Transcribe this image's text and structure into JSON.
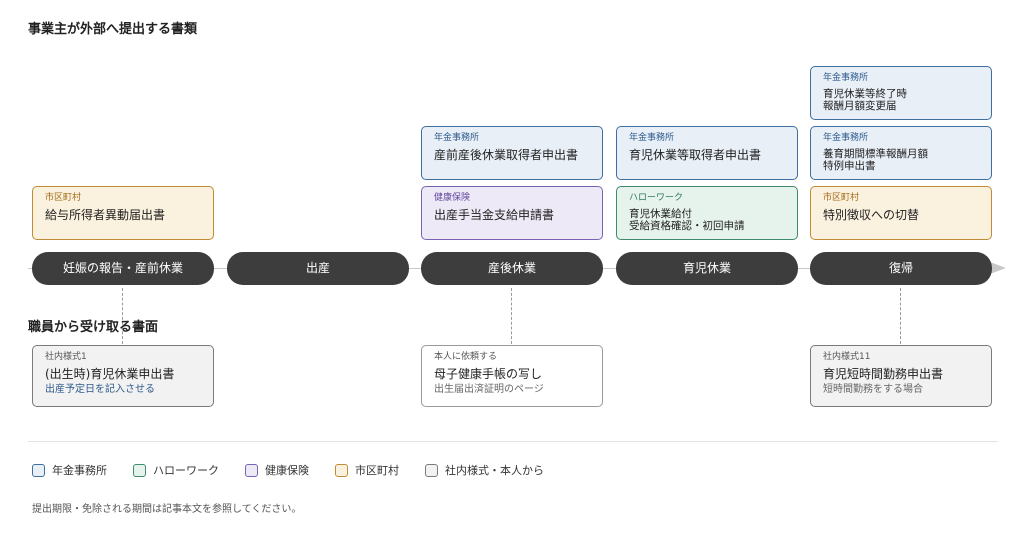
{
  "titles": {
    "external": "事業主が外部へ提出する書類",
    "internal": "職員から受け取る書面"
  },
  "phases": [
    "妊娠の報告・産前休業",
    "出産",
    "産後休業",
    "育児休業",
    "復帰"
  ],
  "external_cards": {
    "phase1_shiku": {
      "org": "市区町村",
      "doc": "給与所得者異動届出書"
    },
    "phase3_nenkin": {
      "org": "年金事務所",
      "doc": "産前産後休業取得者申出書"
    },
    "phase3_kenpo": {
      "org": "健康保険",
      "doc": "出産手当金支給申請書"
    },
    "phase4_nenkin": {
      "org": "年金事務所",
      "doc": "育児休業等取得者申出書"
    },
    "phase4_hello": {
      "org": "ハローワーク",
      "doc_line1": "育児休業給付",
      "doc_line2": "受給資格確認・初回申請"
    },
    "phase5_nenkin_top": {
      "org": "年金事務所",
      "doc_line1": "育児休業等終了時",
      "doc_line2": "報酬月額変更届"
    },
    "phase5_nenkin_mid": {
      "org": "年金事務所",
      "doc_line1": "養育期間標準報酬月額",
      "doc_line2": "特例申出書"
    },
    "phase5_shiku": {
      "org": "市区町村",
      "doc": "特別徴収への切替"
    }
  },
  "internal_cards": {
    "form1": {
      "org": "社内様式1",
      "doc": "(出生時)育児休業申出書",
      "note": "出産予定日を記入させる"
    },
    "honnin": {
      "org": "本人に依頼する",
      "doc": "母子健康手帳の写し",
      "note": "出生届出済証明のページ"
    },
    "form11": {
      "org": "社内様式11",
      "doc": "育児短時間勤務申出書",
      "note": "短時間勤務をする場合"
    }
  },
  "legend": [
    {
      "label": "年金事務所",
      "color": "#3f6fa0"
    },
    {
      "label": "ハローワーク",
      "color": "#3f8a6c"
    },
    {
      "label": "健康保険",
      "color": "#7b61b3"
    },
    {
      "label": "市区町村",
      "color": "#c28a34"
    },
    {
      "label": "社内様式・本人から",
      "color": "#7a7a7a"
    }
  ],
  "footnote": "提出期限・免除される期間は記事本文を参照してください。"
}
